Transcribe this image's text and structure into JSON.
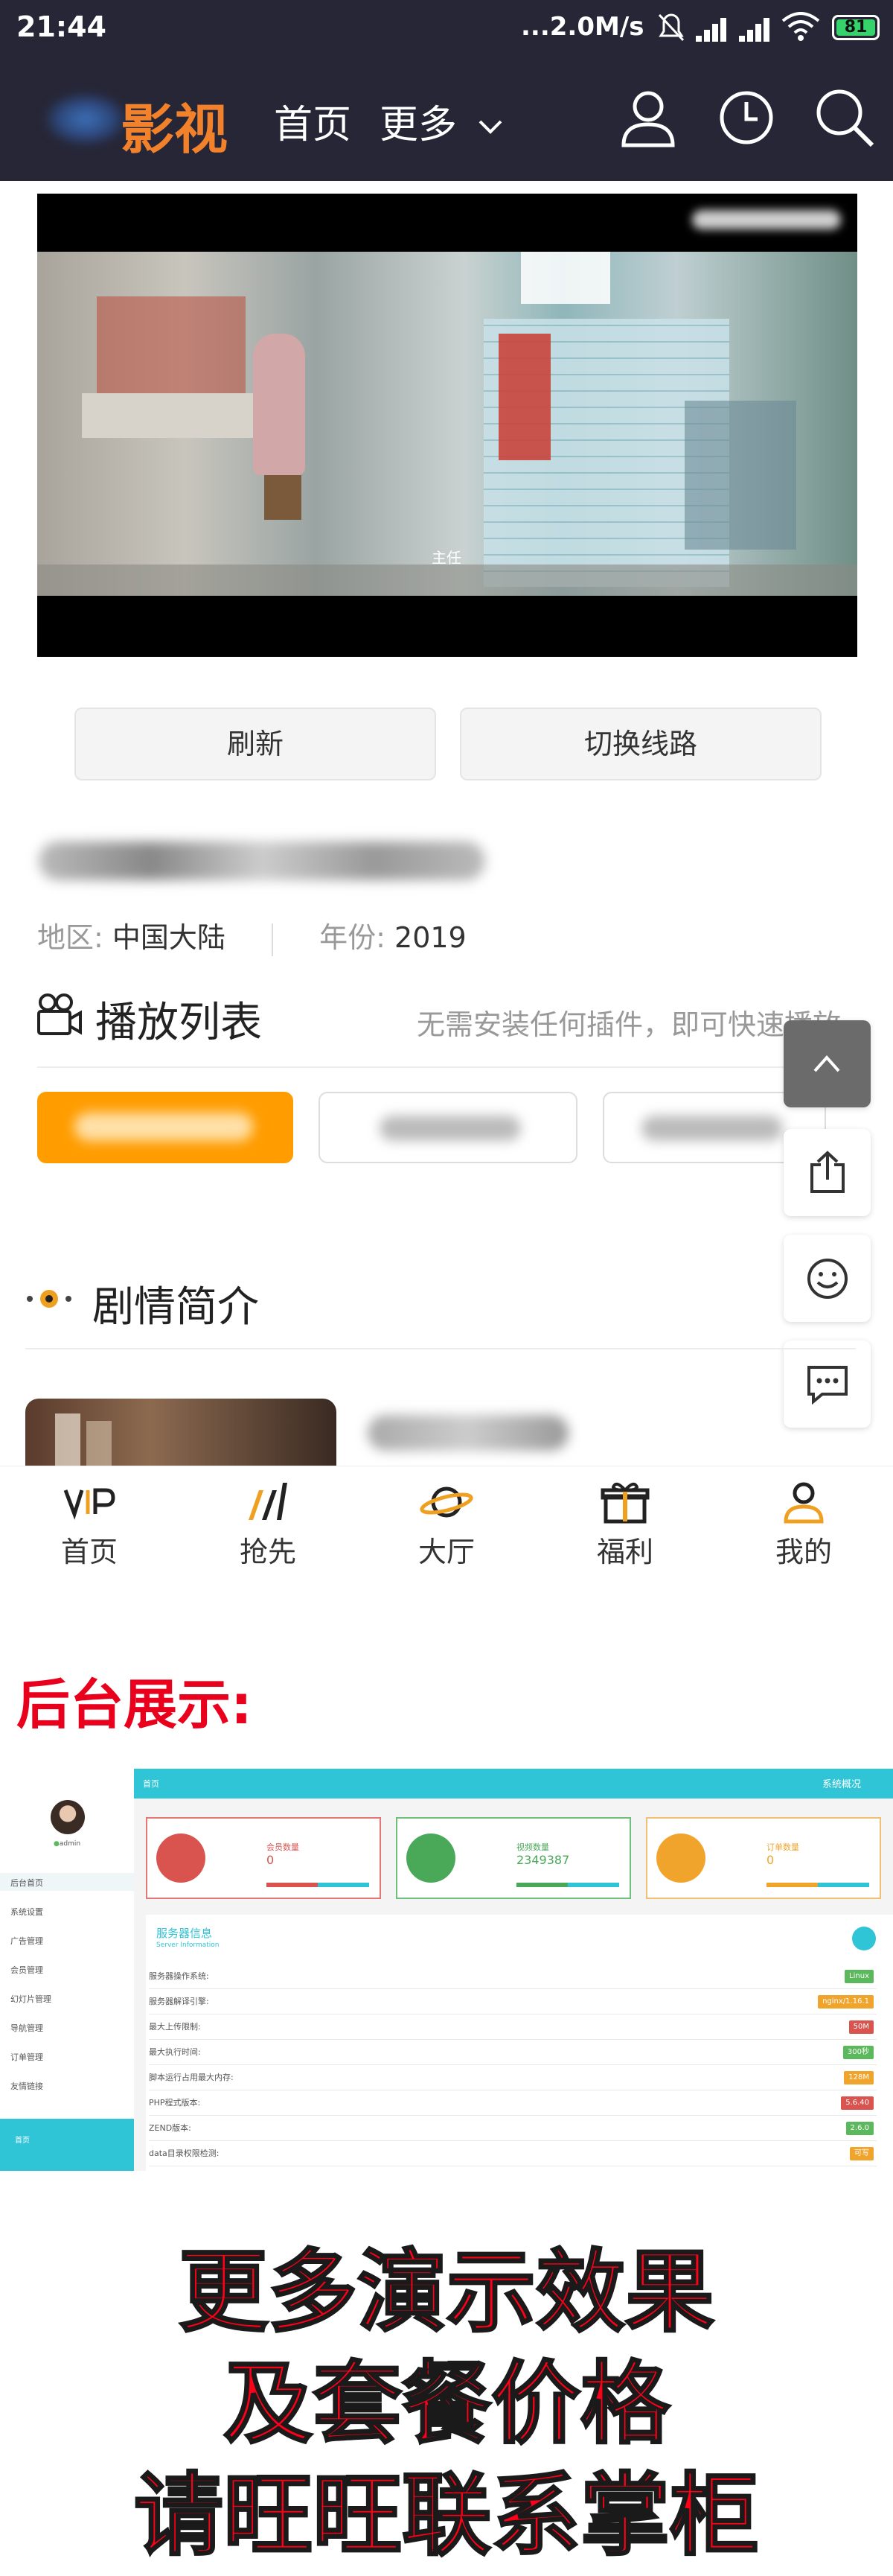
{
  "status_bar": {
    "time": "21:44",
    "network_speed": "...2.0M/s",
    "battery": "81",
    "icons": [
      "mute-icon",
      "signal-icon",
      "signal-icon",
      "wifi-icon",
      "battery-icon"
    ]
  },
  "header": {
    "logo_text": "影视",
    "nav": [
      "首页",
      "更多"
    ],
    "icons": [
      "user-icon",
      "history-icon",
      "search-icon"
    ]
  },
  "player": {
    "subtitle_text": "主任"
  },
  "actions": {
    "refresh": "刷新",
    "switch_line": "切换线路"
  },
  "meta": {
    "region_label": "地区:",
    "region": "中国大陆",
    "year_label": "年份:",
    "year": "2019"
  },
  "playlist": {
    "title": "播放列表",
    "hint": "无需安装任何插件，即可快速播放"
  },
  "synopsis": {
    "title": "剧情简介"
  },
  "tabbar": {
    "tabs": [
      {
        "label": "首页",
        "icon": "vip-icon"
      },
      {
        "label": "抢先",
        "icon": "bars-icon"
      },
      {
        "label": "大厅",
        "icon": "planet-icon"
      },
      {
        "label": "福利",
        "icon": "gift-icon"
      },
      {
        "label": "我的",
        "icon": "person-icon"
      }
    ]
  },
  "promo": {
    "backend_title": "后台展示:",
    "line1": "更多演示效果",
    "line2": "及套餐价格",
    "line3": "请旺旺联系掌柜"
  },
  "admin": {
    "breadcrumb": "首页",
    "top_right": "系统概况",
    "user": "admin",
    "side_nav": [
      "后台首页",
      "系统设置",
      "广告管理",
      "会员管理",
      "幻灯片管理",
      "导航管理",
      "订单管理",
      "友情链接"
    ],
    "side_footer": "首页",
    "cards": [
      {
        "label": "会员数量",
        "value": "0",
        "color": "#d9534f"
      },
      {
        "label": "视频数量",
        "value": "2349387",
        "color": "#49a959"
      },
      {
        "label": "订单数量",
        "value": "0",
        "color": "#f0a42c"
      }
    ],
    "server_title": "服务器信息",
    "server_subtitle": "Server Information",
    "server_rows": [
      {
        "label": "服务器操作系统:",
        "badge": "Linux",
        "color": "#5cb85c"
      },
      {
        "label": "服务器解译引擎:",
        "badge": "nginx/1.16.1",
        "color": "#f0a42c"
      },
      {
        "label": "最大上传限制:",
        "badge": "50M",
        "color": "#d9534f"
      },
      {
        "label": "最大执行时间:",
        "badge": "300秒",
        "color": "#5cb85c"
      },
      {
        "label": "脚本运行占用最大内存:",
        "badge": "128M",
        "color": "#f0a42c"
      },
      {
        "label": "PHP程式版本:",
        "badge": "5.6.40",
        "color": "#d9534f"
      },
      {
        "label": "ZEND版本:",
        "badge": "2.6.0",
        "color": "#5cb85c"
      },
      {
        "label": "data目录权限检测:",
        "badge": "可写",
        "color": "#f0a42c"
      }
    ]
  }
}
